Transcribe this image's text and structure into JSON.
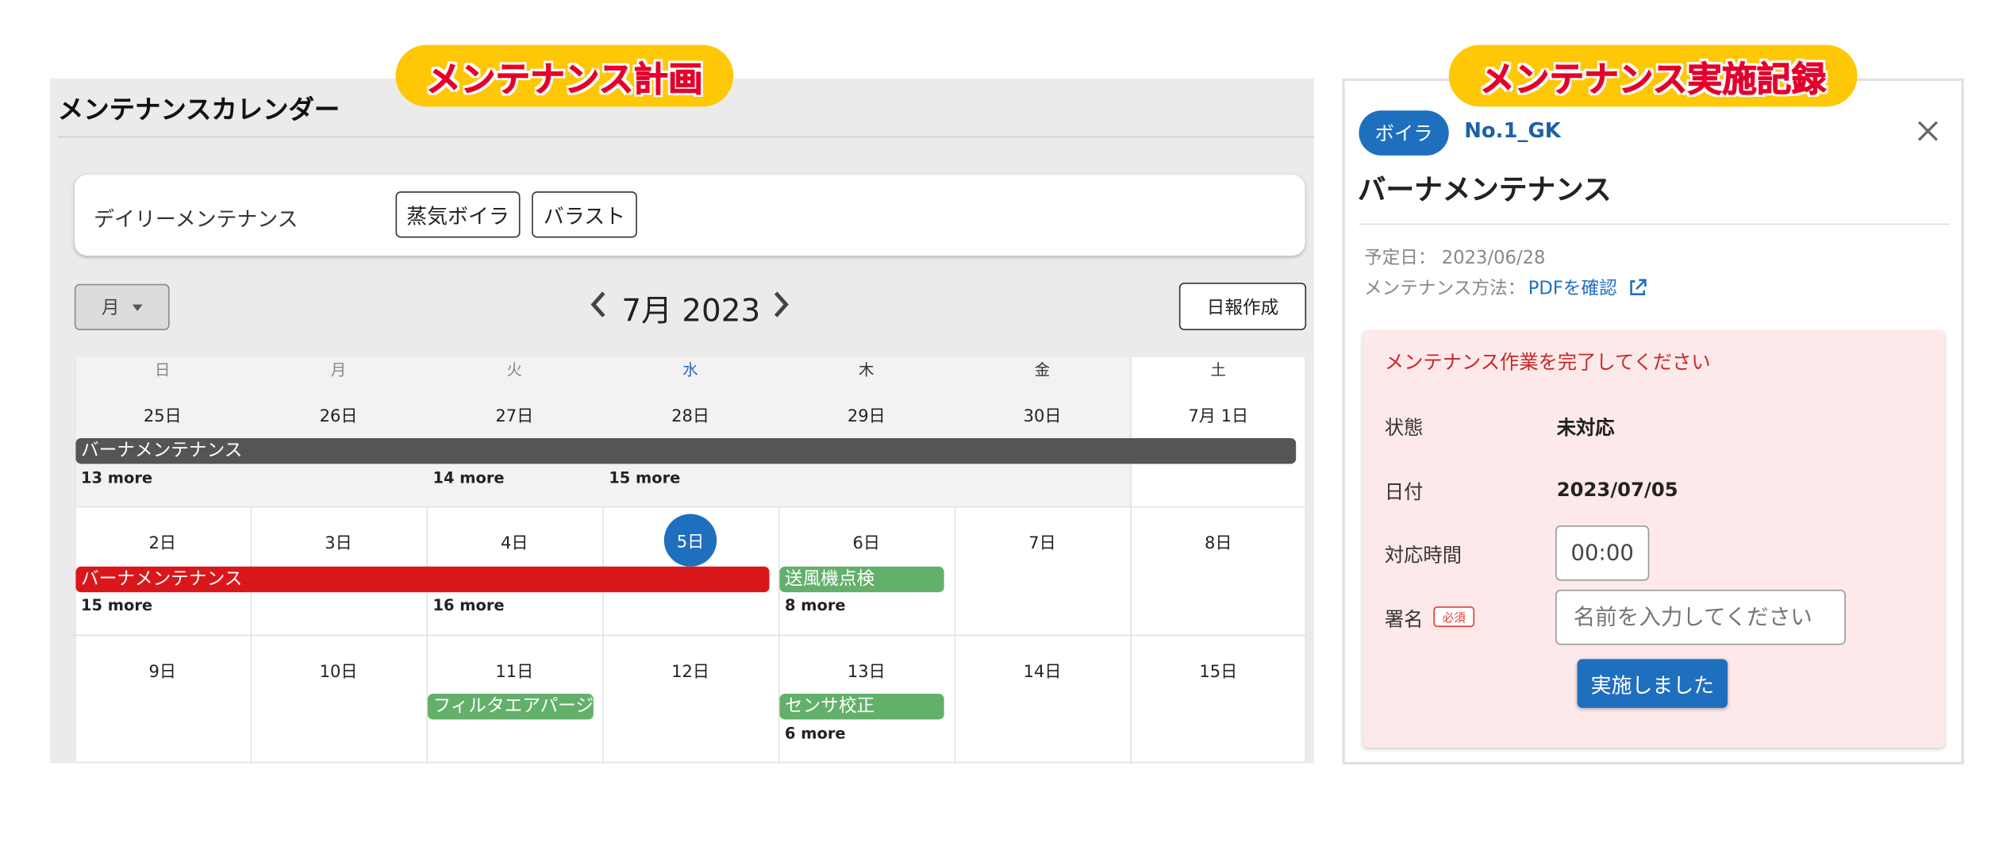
{
  "callouts": {
    "plan": "メンテナンス計画",
    "record": "メンテナンス実施記録"
  },
  "calendar": {
    "title": "メンテナンスカレンダー",
    "daily_label": "デイリーメンテナンス",
    "daily_chips": [
      "蒸気ボイラ",
      "バラスト"
    ],
    "view_select": "月",
    "month_label": "7月 2023",
    "report_button": "日報作成",
    "weekdays": [
      "日",
      "月",
      "火",
      "水",
      "木",
      "金",
      "土"
    ],
    "weeks": [
      {
        "dates": [
          "25日",
          "26日",
          "27日",
          "28日",
          "29日",
          "30日",
          "7月 1日"
        ]
      },
      {
        "dates": [
          "2日",
          "3日",
          "4日",
          "5日",
          "6日",
          "7日",
          "8日"
        ]
      },
      {
        "dates": [
          "9日",
          "10日",
          "11日",
          "12日",
          "13日",
          "14日",
          "15日"
        ]
      }
    ],
    "events": {
      "w1_burner": "バーナメンテナンス",
      "w2_burner": "バーナメンテナンス",
      "w2_fan": "送風機点検",
      "w3_filter": "フィルタエアパージ",
      "w3_sensor": "センサ校正"
    },
    "more": {
      "w1_sun": "13 more",
      "w1_tue": "14 more",
      "w1_wed": "15 more",
      "w2_sun": "15 more",
      "w2_tue": "16 more",
      "w2_thu": "8 more",
      "w3_thu": "6 more"
    },
    "colors": {
      "gray_event": "#555555",
      "red_event": "#d9171b",
      "green_event": "#62b06a",
      "today": "#1f6fbf"
    }
  },
  "record": {
    "equipment_chip": "ボイラ",
    "equipment_id": "No.1_GK",
    "title": "バーナメンテナンス",
    "planned_label": "予定日：",
    "planned_date": "2023/06/28",
    "method_label": "メンテナンス方法：",
    "method_link": "PDFを確認",
    "alert": "メンテナンス作業を完了してください",
    "status_label": "状態",
    "status_value": "未対応",
    "date_label": "日付",
    "date_value": "2023/07/05",
    "time_label": "対応時間",
    "time_value": "00:00",
    "sign_label": "署名",
    "required_badge": "必須",
    "name_placeholder": "名前を入力してください",
    "submit_button": "実施しました"
  }
}
